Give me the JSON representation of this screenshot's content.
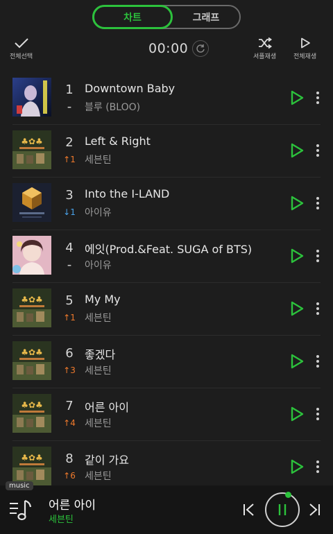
{
  "tabs": {
    "chart": "차트",
    "graph": "그래프"
  },
  "toolbar": {
    "select_all": "전체선택",
    "timer": "00:00",
    "shuffle": "셔플재생",
    "play_all": "전체재생"
  },
  "songs": [
    {
      "rank": "1",
      "change": "–",
      "change_type": "same",
      "title": "Downtown Baby",
      "artist": "블루 (BLOO)",
      "art": "downtown-baby-cover"
    },
    {
      "rank": "2",
      "change": "↑1",
      "change_type": "up",
      "title": "Left & Right",
      "artist": "세븐틴",
      "art": "seventeen-cover"
    },
    {
      "rank": "3",
      "change": "↓1",
      "change_type": "down",
      "title": "Into the I-LAND",
      "artist": "아이유",
      "art": "into-the-iland-cover"
    },
    {
      "rank": "4",
      "change": "–",
      "change_type": "same",
      "title": "에잇(Prod.&Feat. SUGA of BTS)",
      "artist": "아이유",
      "art": "eight-cover"
    },
    {
      "rank": "5",
      "change": "↑1",
      "change_type": "up",
      "title": "My My",
      "artist": "세븐틴",
      "art": "seventeen-cover"
    },
    {
      "rank": "6",
      "change": "↑3",
      "change_type": "up",
      "title": "좋겠다",
      "artist": "세븐틴",
      "art": "seventeen-cover"
    },
    {
      "rank": "7",
      "change": "↑4",
      "change_type": "up",
      "title": "어른 아이",
      "artist": "세븐틴",
      "art": "seventeen-cover"
    },
    {
      "rank": "8",
      "change": "↑6",
      "change_type": "up",
      "title": "같이 가요",
      "artist": "세븐틴",
      "art": "seventeen-cover"
    }
  ],
  "player": {
    "tag": "music",
    "title": "어른 아이",
    "artist": "세븐틴"
  },
  "colors": {
    "accent": "#2cc23c",
    "up": "#f07a2c",
    "down": "#4aa4ec",
    "background": "#1d1d1d"
  }
}
